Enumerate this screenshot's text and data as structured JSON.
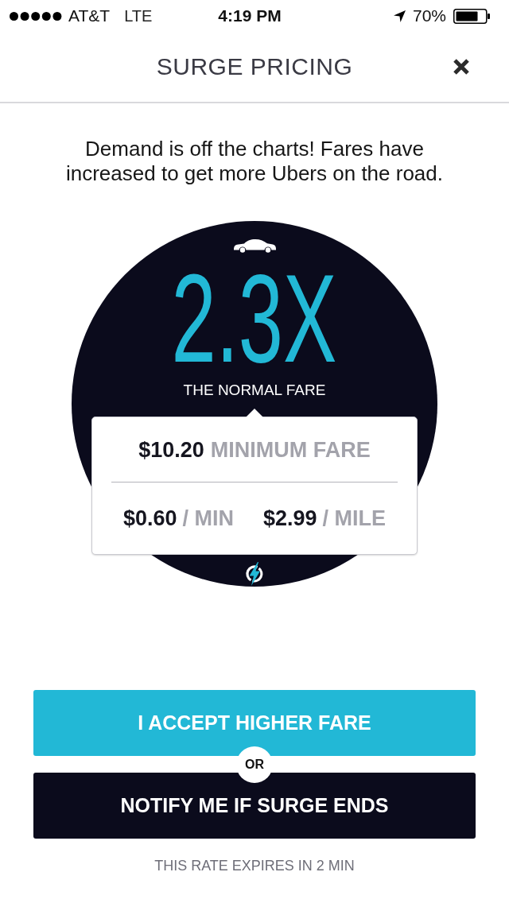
{
  "status_bar": {
    "carrier": "AT&T",
    "network": "LTE",
    "time": "4:19 PM",
    "battery": "70%"
  },
  "header": {
    "title": "SURGE PRICING"
  },
  "message": "Demand is off the charts! Fares have increased to get more Ubers on the road.",
  "surge": {
    "multiplier": "2.3X",
    "caption": "THE NORMAL FARE"
  },
  "fare_card": {
    "minimum": {
      "amount": "$10.20",
      "label": "MINIMUM FARE"
    },
    "rates": [
      {
        "amount": "$0.60",
        "unit": "/ MIN"
      },
      {
        "amount": "$2.99",
        "unit": "/ MILE"
      }
    ]
  },
  "actions": {
    "primary": "I ACCEPT HIGHER FARE",
    "separator": "OR",
    "secondary": "NOTIFY ME IF SURGE ENDS"
  },
  "footer": "THIS RATE EXPIRES IN 2 MIN"
}
